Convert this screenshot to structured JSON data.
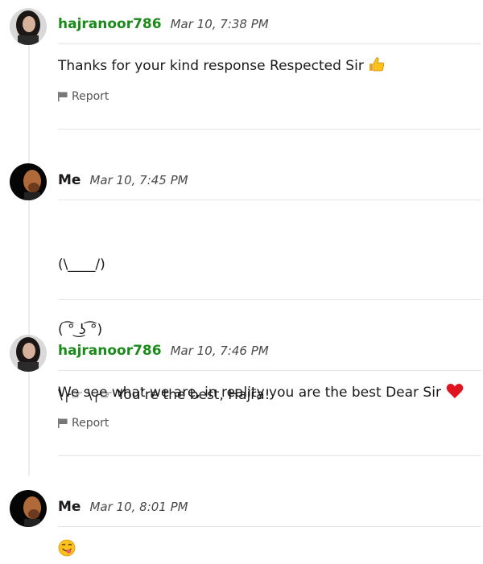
{
  "messages": [
    {
      "author": "hajranoor786",
      "timestamp": "Mar 10, 7:38 PM",
      "text": "Thanks for your kind response Respected Sir",
      "emoji": "thumbs-up-icon",
      "report_label": "Report"
    },
    {
      "author": "Me",
      "timestamp": "Mar 10, 7:45 PM",
      "lines": [
        "(\\____/)",
        "( ͡° ͜ʖ ͡°)",
        "\\╭☞ \\╭☞ You’re the best, Hajra!"
      ]
    },
    {
      "author": "hajranoor786",
      "timestamp": "Mar 10, 7:46 PM",
      "text": "We see what we are, in reality you are the best Dear Sir",
      "emoji": "red-heart-icon",
      "report_label": "Report"
    },
    {
      "author": "Me",
      "timestamp": "Mar 10, 8:01 PM",
      "emoji": "smiling-face-tongue-icon"
    }
  ],
  "colors": {
    "other_user": "#1a8a1a",
    "me_user": "#1a1a1a",
    "divider": "#e4e4e4"
  }
}
